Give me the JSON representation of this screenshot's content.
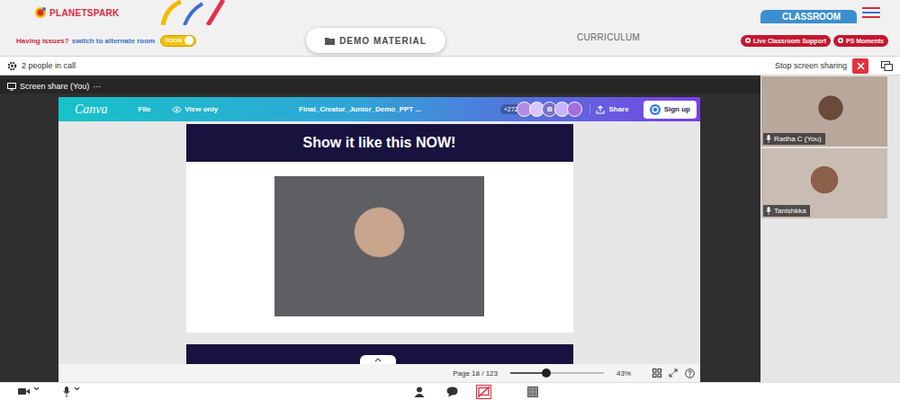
{
  "header": {
    "logo": "PLANETSPARK",
    "classroom_tab": "CLASSROOM",
    "issues_text": "Having issues?",
    "switch_link": "switch to alternate room",
    "room_toggle": {
      "label": "ROOM",
      "on": true
    },
    "demo_button": "DEMO MATERIAL",
    "curriculum": "CURRICULUM",
    "pills": [
      "Live Classroom Support",
      "PS Moments"
    ]
  },
  "call_bar": {
    "people": "2 people in call",
    "stop_sharing": "Stop screen sharing"
  },
  "share": {
    "title": "Screen share (You)",
    "more": "···"
  },
  "canva": {
    "logo": "Canva",
    "menu": [
      "File"
    ],
    "view_only": "View only",
    "doc_title": "Final_Creator_Junior_Demo_PPT ...",
    "collaborators_count": "+272",
    "avatar_letter": "B",
    "share": "Share",
    "sign_up": "Sign up",
    "slide_title": "Show it like this NOW!",
    "page": "Page 18 / 123",
    "zoom": {
      "level": 0.38,
      "reading": "43%"
    }
  },
  "participants": [
    {
      "name": "Radha C (You)"
    },
    {
      "name": "Tanishkka"
    }
  ]
}
